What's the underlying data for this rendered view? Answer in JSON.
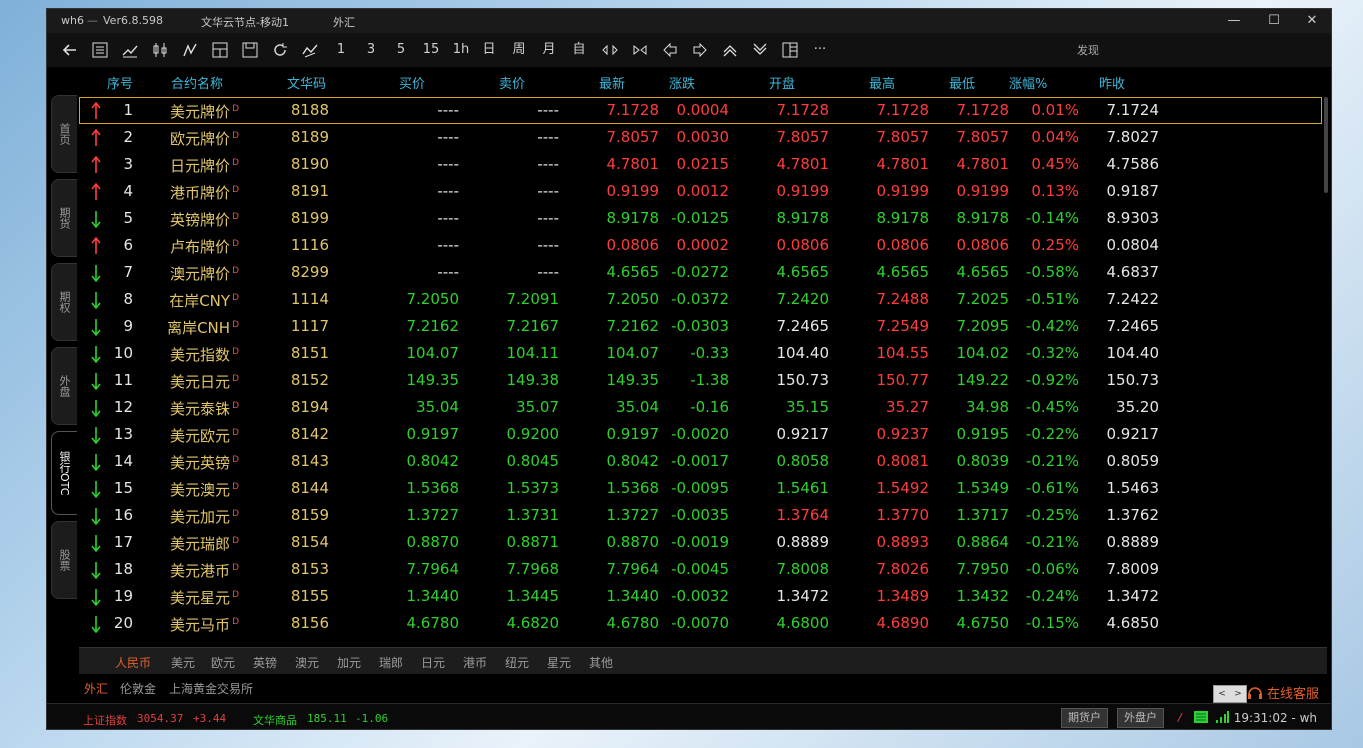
{
  "window": {
    "app_label": "wh6",
    "version": "Ver6.8.598",
    "server": "文华云节点-移动1",
    "section": "外汇",
    "min": "—",
    "max": "☐",
    "close": "✕"
  },
  "toolbar": {
    "periods": [
      "1",
      "3",
      "5",
      "15",
      "1h",
      "日",
      "周",
      "月",
      "自"
    ],
    "more": "···",
    "discover": "发现"
  },
  "side_tabs": [
    "首页",
    "期货",
    "期权",
    "外盘",
    "银行OTC",
    "股票"
  ],
  "table": {
    "headers": {
      "no": "序号",
      "name": "合约名称",
      "code": "文华码",
      "bid": "买价",
      "ask": "卖价",
      "last": "最新",
      "chg": "涨跌",
      "open": "开盘",
      "high": "最高",
      "low": "最低",
      "pct": "涨幅%",
      "prev": "昨收"
    },
    "rows": [
      {
        "dir": "up",
        "no": "1",
        "name": "美元牌价",
        "code": "8188",
        "bid": "----",
        "ask": "----",
        "last": "7.1728",
        "chg": "0.0004",
        "open": "7.1728",
        "high": "7.1728",
        "low": "7.1728",
        "pct": "0.01%",
        "prev": "7.1724"
      },
      {
        "dir": "up",
        "no": "2",
        "name": "欧元牌价",
        "code": "8189",
        "bid": "----",
        "ask": "----",
        "last": "7.8057",
        "chg": "0.0030",
        "open": "7.8057",
        "high": "7.8057",
        "low": "7.8057",
        "pct": "0.04%",
        "prev": "7.8027"
      },
      {
        "dir": "up",
        "no": "3",
        "name": "日元牌价",
        "code": "8190",
        "bid": "----",
        "ask": "----",
        "last": "4.7801",
        "chg": "0.0215",
        "open": "4.7801",
        "high": "4.7801",
        "low": "4.7801",
        "pct": "0.45%",
        "prev": "4.7586"
      },
      {
        "dir": "up",
        "no": "4",
        "name": "港币牌价",
        "code": "8191",
        "bid": "----",
        "ask": "----",
        "last": "0.9199",
        "chg": "0.0012",
        "open": "0.9199",
        "high": "0.9199",
        "low": "0.9199",
        "pct": "0.13%",
        "prev": "0.9187"
      },
      {
        "dir": "down",
        "no": "5",
        "name": "英镑牌价",
        "code": "8199",
        "bid": "----",
        "ask": "----",
        "last": "8.9178",
        "chg": "-0.0125",
        "open": "8.9178",
        "high": "8.9178",
        "low": "8.9178",
        "pct": "-0.14%",
        "prev": "8.9303"
      },
      {
        "dir": "up",
        "no": "6",
        "name": "卢布牌价",
        "code": "1116",
        "bid": "----",
        "ask": "----",
        "last": "0.0806",
        "chg": "0.0002",
        "open": "0.0806",
        "high": "0.0806",
        "low": "0.0806",
        "pct": "0.25%",
        "prev": "0.0804"
      },
      {
        "dir": "down",
        "no": "7",
        "name": "澳元牌价",
        "code": "8299",
        "bid": "----",
        "ask": "----",
        "last": "4.6565",
        "chg": "-0.0272",
        "open": "4.6565",
        "high": "4.6565",
        "low": "4.6565",
        "pct": "-0.58%",
        "prev": "4.6837"
      },
      {
        "dir": "down",
        "no": "8",
        "name": "在岸CNY",
        "code": "1114",
        "bid": "7.2050",
        "ask": "7.2091",
        "last": "7.2050",
        "chg": "-0.0372",
        "open": "7.2420",
        "high": "7.2488",
        "low": "7.2025",
        "pct": "-0.51%",
        "prev": "7.2422"
      },
      {
        "dir": "down",
        "no": "9",
        "name": "离岸CNH",
        "code": "1117",
        "bid": "7.2162",
        "ask": "7.2167",
        "last": "7.2162",
        "chg": "-0.0303",
        "open": "7.2465",
        "high": "7.2549",
        "low": "7.2095",
        "pct": "-0.42%",
        "prev": "7.2465"
      },
      {
        "dir": "down",
        "no": "10",
        "name": "美元指数",
        "code": "8151",
        "bid": "104.07",
        "ask": "104.11",
        "last": "104.07",
        "chg": "-0.33",
        "open": "104.40",
        "high": "104.55",
        "low": "104.02",
        "pct": "-0.32%",
        "prev": "104.40"
      },
      {
        "dir": "down",
        "no": "11",
        "name": "美元日元",
        "code": "8152",
        "bid": "149.35",
        "ask": "149.38",
        "last": "149.35",
        "chg": "-1.38",
        "open": "150.73",
        "high": "150.77",
        "low": "149.22",
        "pct": "-0.92%",
        "prev": "150.73"
      },
      {
        "dir": "down",
        "no": "12",
        "name": "美元泰铢",
        "code": "8194",
        "bid": "35.04",
        "ask": "35.07",
        "last": "35.04",
        "chg": "-0.16",
        "open": "35.15",
        "high": "35.27",
        "low": "34.98",
        "pct": "-0.45%",
        "prev": "35.20"
      },
      {
        "dir": "down",
        "no": "13",
        "name": "美元欧元",
        "code": "8142",
        "bid": "0.9197",
        "ask": "0.9200",
        "last": "0.9197",
        "chg": "-0.0020",
        "open": "0.9217",
        "high": "0.9237",
        "low": "0.9195",
        "pct": "-0.22%",
        "prev": "0.9217"
      },
      {
        "dir": "down",
        "no": "14",
        "name": "美元英镑",
        "code": "8143",
        "bid": "0.8042",
        "ask": "0.8045",
        "last": "0.8042",
        "chg": "-0.0017",
        "open": "0.8058",
        "high": "0.8081",
        "low": "0.8039",
        "pct": "-0.21%",
        "prev": "0.8059"
      },
      {
        "dir": "down",
        "no": "15",
        "name": "美元澳元",
        "code": "8144",
        "bid": "1.5368",
        "ask": "1.5373",
        "last": "1.5368",
        "chg": "-0.0095",
        "open": "1.5461",
        "high": "1.5492",
        "low": "1.5349",
        "pct": "-0.61%",
        "prev": "1.5463"
      },
      {
        "dir": "down",
        "no": "16",
        "name": "美元加元",
        "code": "8159",
        "bid": "1.3727",
        "ask": "1.3731",
        "last": "1.3727",
        "chg": "-0.0035",
        "open": "1.3764",
        "high": "1.3770",
        "low": "1.3717",
        "pct": "-0.25%",
        "prev": "1.3762"
      },
      {
        "dir": "down",
        "no": "17",
        "name": "美元瑞郎",
        "code": "8154",
        "bid": "0.8870",
        "ask": "0.8871",
        "last": "0.8870",
        "chg": "-0.0019",
        "open": "0.8889",
        "high": "0.8893",
        "low": "0.8864",
        "pct": "-0.21%",
        "prev": "0.8889"
      },
      {
        "dir": "down",
        "no": "18",
        "name": "美元港币",
        "code": "8153",
        "bid": "7.7964",
        "ask": "7.7968",
        "last": "7.7964",
        "chg": "-0.0045",
        "open": "7.8008",
        "high": "7.8026",
        "low": "7.7950",
        "pct": "-0.06%",
        "prev": "7.8009"
      },
      {
        "dir": "down",
        "no": "19",
        "name": "美元星元",
        "code": "8155",
        "bid": "1.3440",
        "ask": "1.3445",
        "last": "1.3440",
        "chg": "-0.0032",
        "open": "1.3472",
        "high": "1.3489",
        "low": "1.3432",
        "pct": "-0.24%",
        "prev": "1.3472"
      },
      {
        "dir": "down",
        "no": "20",
        "name": "美元马币",
        "code": "8156",
        "bid": "4.6780",
        "ask": "4.6820",
        "last": "4.6780",
        "chg": "-0.0070",
        "open": "4.6800",
        "high": "4.6890",
        "low": "4.6750",
        "pct": "-0.15%",
        "prev": "4.6850"
      }
    ],
    "superscript": "D",
    "colors": {
      "up": "#ff3d3d",
      "down": "#2ed12e",
      "flat": "#e6e6e6",
      "name": "#e1c56a",
      "header": "#3fb6d8"
    }
  },
  "currency_tabs": [
    "人民币",
    "美元",
    "欧元",
    "英镑",
    "澳元",
    "加元",
    "瑞郎",
    "日元",
    "港币",
    "纽元",
    "星元",
    "其他"
  ],
  "market_tabs": [
    "外汇",
    "伦敦金",
    "上海黄金交易所"
  ],
  "page_nav": {
    "prev": "<",
    "next": ">"
  },
  "online_service": "在线客服",
  "status": {
    "idx1_name": "上证指数",
    "idx1_value": "3054.37",
    "idx1_chg": "+3.44",
    "idx2_name": "文华商品",
    "idx2_value": "185.11",
    "idx2_chg": "-1.06",
    "acct_futures": "期货户",
    "acct_foreign": "外盘户",
    "slash": "/",
    "clock": "19:31:02 - wh"
  }
}
